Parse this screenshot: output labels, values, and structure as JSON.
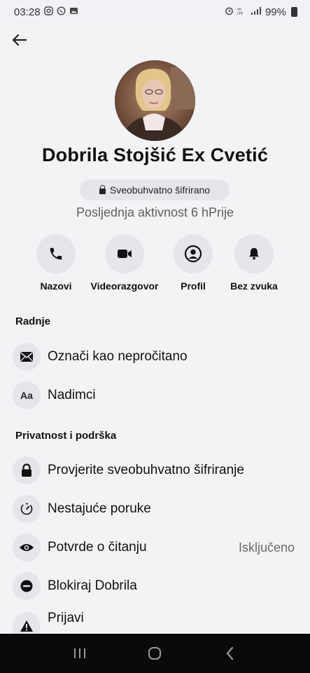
{
  "status_bar": {
    "time": "03:28",
    "left_icons": [
      "instagram-icon",
      "whatsapp-icon",
      "gallery-icon"
    ],
    "right_icons": [
      "alarm-icon",
      "volte-icon",
      "signal-icon"
    ],
    "battery": "99%"
  },
  "header": {
    "back_icon": "arrow-left-icon"
  },
  "profile": {
    "name": "Dobrila Stojšić Ex Cvetić",
    "e2e_label": "Sveobuhvatno šifrirano",
    "last_active": "Posljednja aktivnost 6 hPrije"
  },
  "actions": [
    {
      "label": "Nazovi",
      "icon": "phone-icon"
    },
    {
      "label": "Videorazgovor",
      "icon": "video-camera-icon"
    },
    {
      "label": "Profil",
      "icon": "profile-icon"
    },
    {
      "label": "Bez zvuka",
      "icon": "bell-icon"
    }
  ],
  "sections": {
    "actions_title": "Radnje",
    "privacy_title": "Privatnost i podrška"
  },
  "action_rows": [
    {
      "label": "Označi kao nepročitano",
      "icon": "envelope-icon"
    },
    {
      "label": "Nadimci",
      "icon": "font-aa-icon",
      "icon_text": "Aa"
    }
  ],
  "privacy_rows": [
    {
      "label": "Provjerite sveobuhvatno šifriranje",
      "icon": "lock-icon"
    },
    {
      "label": "Nestajuće poruke",
      "icon": "timer-icon"
    },
    {
      "label": "Potvrde o čitanju",
      "icon": "eye-icon",
      "value": "Isključeno"
    },
    {
      "label": "Blokiraj Dobrila",
      "icon": "block-icon"
    },
    {
      "label": "Prijavi",
      "icon": "warning-icon"
    }
  ],
  "nav_bar": {
    "buttons": [
      "recent-apps-icon",
      "home-icon",
      "back-icon"
    ]
  }
}
